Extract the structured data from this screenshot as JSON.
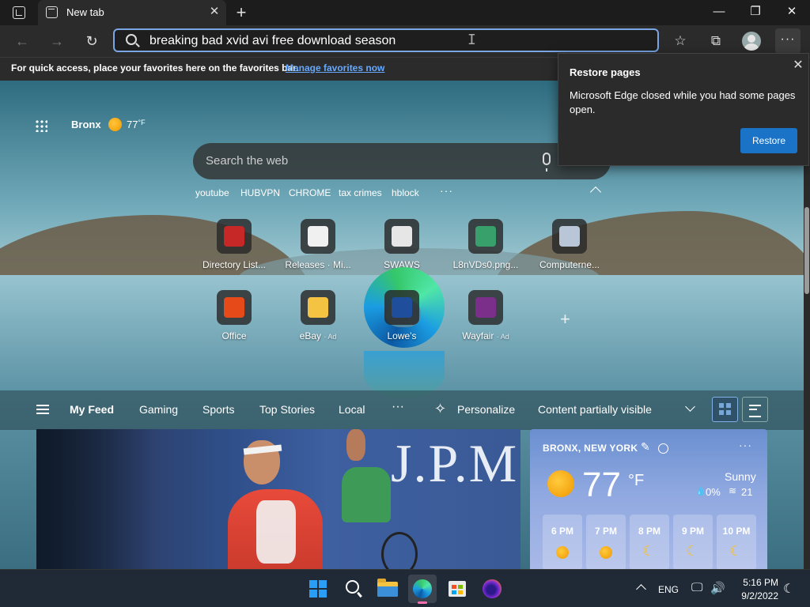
{
  "window": {
    "tab_title": "New tab",
    "tab_close": "✕",
    "new_tab": "+",
    "minimize": "—",
    "restore": "❐",
    "close": "✕"
  },
  "toolbar": {
    "back": "←",
    "forward": "→",
    "refresh": "↻",
    "address_value": "breaking bad xvid avi free download season",
    "favorites_icon": "☆",
    "collections_icon": "⧉",
    "more": "···"
  },
  "favbar": {
    "text": "For quick access, place your favorites here on the favorites bar.",
    "link": "Manage favorites now"
  },
  "popup": {
    "title": "Restore pages",
    "message": "Microsoft Edge closed while you had some pages open.",
    "button": "Restore",
    "close": "✕"
  },
  "ntp": {
    "location": "Bronx",
    "temp": "77",
    "unit": "°F",
    "search_placeholder": "Search the web",
    "quick_links": [
      "youtube",
      "HUBVPN",
      "CHROME",
      "tax crimes",
      "hblock"
    ],
    "quick_more": "···",
    "add_tile": "+",
    "tiles": [
      {
        "label": "Directory List...",
        "ad": "",
        "color": "#c62828"
      },
      {
        "label": "Releases · Mi...",
        "ad": "",
        "color": "#f0f0f0"
      },
      {
        "label": "SWAWS",
        "ad": "",
        "color": "#e6e6e6"
      },
      {
        "label": "L8nVDs0.png...",
        "ad": "",
        "color": "#38a06a"
      },
      {
        "label": "Computerne...",
        "ad": "",
        "color": "#b8c6d8"
      },
      {
        "label": "Office",
        "ad": "",
        "color": "#e64a19"
      },
      {
        "label": "eBay",
        "ad": "· Ad",
        "color": "#f5c342"
      },
      {
        "label": "Lowe's",
        "ad": "",
        "color": "#1f4e9c"
      },
      {
        "label": "Wayfair",
        "ad": "· Ad",
        "color": "#7b2f8a"
      }
    ]
  },
  "feed": {
    "tabs": [
      "My Feed",
      "Gaming",
      "Sports",
      "Top Stories",
      "Local"
    ],
    "more": "···",
    "personalize": "Personalize",
    "visibility": "Content partially visible",
    "news_image_text": "J.P.M"
  },
  "weather": {
    "location": "BRONX, NEW YORK",
    "temp": "77",
    "unit": "°F",
    "condition": "Sunny",
    "precip": "0%",
    "wind": "21",
    "more": "···",
    "hours": [
      {
        "label": "6 PM",
        "icon": "sun"
      },
      {
        "label": "7 PM",
        "icon": "sun"
      },
      {
        "label": "8 PM",
        "icon": "moon"
      },
      {
        "label": "9 PM",
        "icon": "moon"
      },
      {
        "label": "10 PM",
        "icon": "moon"
      }
    ]
  },
  "taskbar": {
    "lang": "ENG",
    "time": "5:16 PM",
    "date": "9/2/2022"
  }
}
